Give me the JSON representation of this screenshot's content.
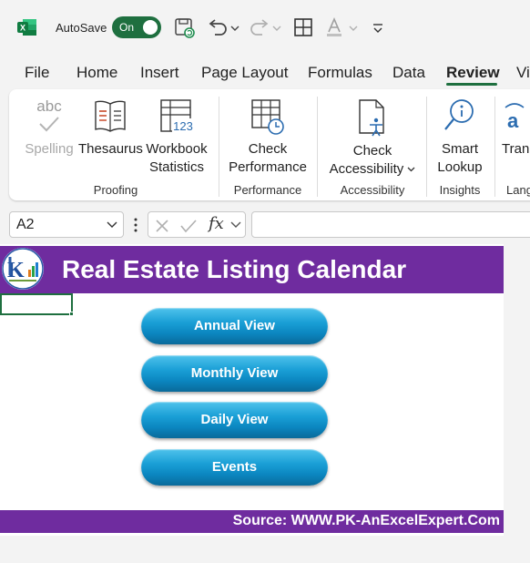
{
  "titlebar": {
    "autosave_label": "AutoSave",
    "autosave_state": "On"
  },
  "tabs": [
    {
      "label": "File"
    },
    {
      "label": "Home"
    },
    {
      "label": "Insert"
    },
    {
      "label": "Page Layout"
    },
    {
      "label": "Formulas"
    },
    {
      "label": "Data"
    },
    {
      "label": "Review",
      "active": true
    },
    {
      "label": "Vi"
    }
  ],
  "ribbon": {
    "spelling": {
      "icon_text": "abc",
      "label": "Spelling"
    },
    "thesaurus": {
      "label": "Thesaurus"
    },
    "workbook_statistics": {
      "line1": "Workbook",
      "line2": "Statistics",
      "icon_text": "123"
    },
    "check_performance": {
      "line1": "Check",
      "line2": "Performance"
    },
    "check_accessibility": {
      "line1": "Check",
      "line2": "Accessibility"
    },
    "smart_lookup": {
      "line1": "Smart",
      "line2": "Lookup"
    },
    "translate": {
      "label": "Tran"
    },
    "groups": {
      "proofing": "Proofing",
      "performance": "Performance",
      "accessibility": "Accessibility",
      "insights": "Insights",
      "language": "Lang"
    }
  },
  "formula_bar": {
    "name_box": "A2",
    "fx": "fx",
    "value": ""
  },
  "sheet": {
    "title": "Real Estate Listing Calendar",
    "buttons": [
      "Annual View",
      "Monthly View",
      "Daily View",
      "Events"
    ],
    "footer": "Source: WWW.PK-AnExcelExpert.Com"
  },
  "colors": {
    "accent_green": "#1e6f3f",
    "banner_purple": "#6f2c9f",
    "button_blue": "#1a9fd6"
  }
}
